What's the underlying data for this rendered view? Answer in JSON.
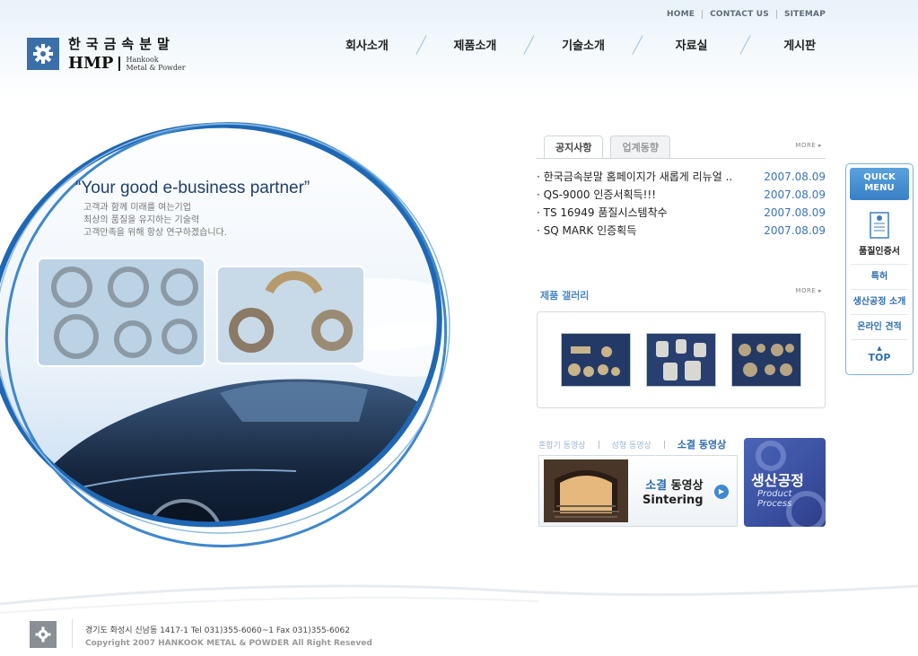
{
  "header": {
    "top_links": [
      "HOME",
      "CONTACT US",
      "SITEMAP"
    ],
    "logo": {
      "korean": "한국금속분말",
      "abbr": "HMP",
      "english_line1": "Hankook",
      "english_line2": "Metal & Powder"
    },
    "nav": [
      "회사소개",
      "제품소개",
      "기술소개",
      "자료실",
      "게시판"
    ]
  },
  "hero": {
    "slogan": "“Your good e-business partner”",
    "lines": [
      "고객과 함께 미래를 여는기업",
      "최상의 품질을 유지하는 기술력",
      "고객만족을 위해 항상 연구하겠습니다."
    ]
  },
  "board": {
    "tabs": [
      "공지사항",
      "업계동향"
    ],
    "more": "MORE ▸",
    "items": [
      {
        "title": "· 한국금속분말 홈페이지가 새롭게 리뉴얼 ..",
        "date": "2007.08.09"
      },
      {
        "title": "· QS-9000 인증서획득!!!",
        "date": "2007.08.09"
      },
      {
        "title": "· TS 16949 품질시스템착수",
        "date": "2007.08.09"
      },
      {
        "title": "· SQ MARK 인증획득",
        "date": "2007.08.09"
      }
    ]
  },
  "gallery": {
    "title": "제품 갤러리",
    "more": "MORE ▸"
  },
  "video": {
    "tabs": [
      "혼합기 동영상",
      "성형 동영상",
      "소결 동영상"
    ],
    "label_highlight": "소결",
    "label_rest": " 동영상",
    "label_en": "Sintering",
    "play": "▶"
  },
  "process_banner": {
    "korean": "생산공정",
    "english": "Product Process"
  },
  "quick_menu": {
    "header_line1": "QUICK",
    "header_line2": "MENU",
    "items": [
      "품질인증서",
      "특허",
      "생산공정 소개",
      "온라인 견적"
    ],
    "top": "TOP",
    "top_arrow": "▲"
  },
  "footer": {
    "address": "경기도 화성시 신남동 1417-1   Tel 031)355-6060~1   Fax 031)355-6062",
    "copyright": "Copyright 2007 HANKOOK METAL & POWDER All Right Reseved"
  },
  "colors": {
    "accent": "#3a72b8",
    "quick_border": "#7fb0da",
    "banner": "#3a4fa0"
  }
}
